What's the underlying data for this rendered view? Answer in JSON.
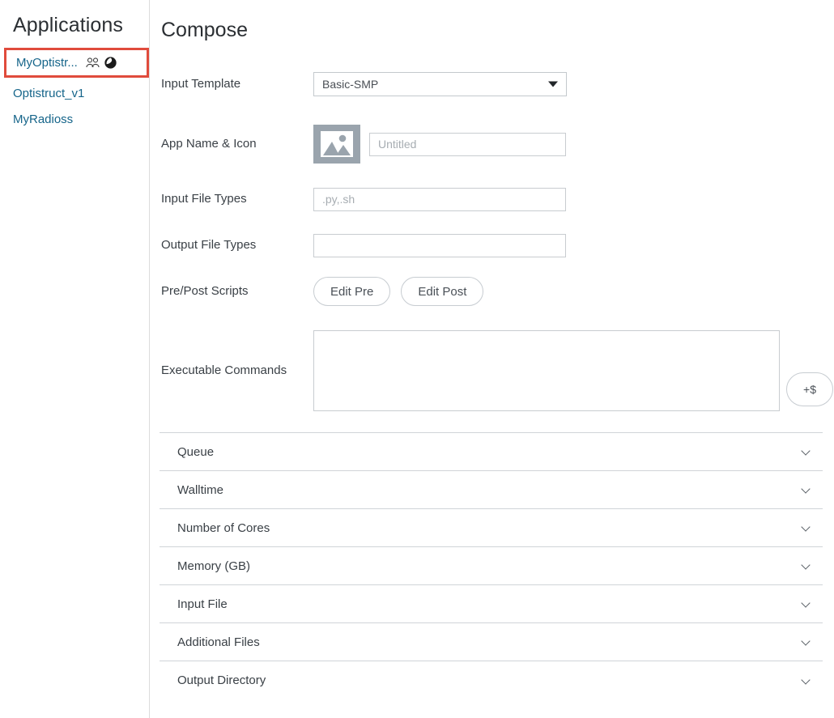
{
  "sidebar": {
    "title": "Applications",
    "items": [
      {
        "label": "MyOptistr...",
        "selected": true,
        "icons": [
          "users-icon",
          "globe-icon"
        ]
      },
      {
        "label": "Optistruct_v1",
        "selected": false,
        "icons": []
      },
      {
        "label": "MyRadioss",
        "selected": false,
        "icons": []
      }
    ],
    "link_color": "#16658a",
    "selection_outline_color": "#e04b3c"
  },
  "main": {
    "title": "Compose",
    "fields": {
      "input_template": {
        "label": "Input Template",
        "value": "Basic-SMP"
      },
      "app_name_icon": {
        "label": "App Name & Icon",
        "icon": "image-placeholder-icon",
        "value": "",
        "placeholder": "Untitled"
      },
      "input_file_types": {
        "label": "Input File Types",
        "value": "",
        "placeholder": ".py,.sh"
      },
      "output_file_types": {
        "label": "Output File Types",
        "value": "",
        "placeholder": ""
      },
      "pre_post_scripts": {
        "label": "Pre/Post Scripts",
        "edit_pre_label": "Edit Pre",
        "edit_post_label": "Edit Post"
      },
      "executable_commands": {
        "label": "Executable Commands",
        "value": "",
        "placeholder": "",
        "add_variable_label": "+$"
      }
    },
    "accordion": [
      {
        "label": "Queue",
        "expanded": false,
        "chevron": "chevron-down-icon"
      },
      {
        "label": "Walltime",
        "expanded": false,
        "chevron": "chevron-down-icon"
      },
      {
        "label": "Number of Cores",
        "expanded": false,
        "chevron": "chevron-down-icon"
      },
      {
        "label": "Memory (GB)",
        "expanded": false,
        "chevron": "chevron-down-icon"
      },
      {
        "label": "Input File",
        "expanded": false,
        "chevron": "chevron-down-icon"
      },
      {
        "label": "Additional Files",
        "expanded": false,
        "chevron": "chevron-down-icon"
      },
      {
        "label": "Output Directory",
        "expanded": false,
        "chevron": "chevron-down-icon"
      }
    ]
  }
}
